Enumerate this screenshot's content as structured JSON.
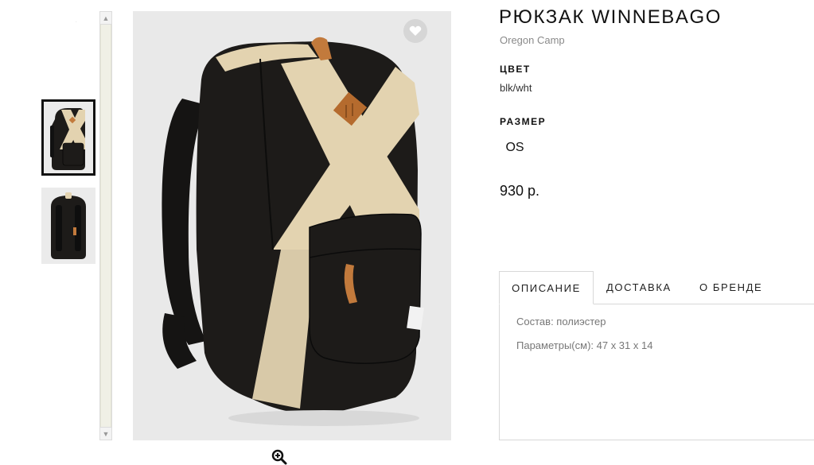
{
  "product": {
    "title": "РЮКЗАК WINNEBAGO",
    "brand": "Oregon Camp",
    "color_label": "ЦВЕТ",
    "color_value": "blk/wht",
    "size_label": "РАЗМЕР",
    "sizes": [
      "OS"
    ],
    "price": "930 р."
  },
  "tabs": [
    {
      "label": "ОПИСАНИЕ",
      "active": true
    },
    {
      "label": "ДОСТАВКА",
      "active": false
    },
    {
      "label": "О БРЕНДЕ",
      "active": false
    }
  ],
  "description": {
    "composition": "Состав: полиэстер",
    "params": "Параметры(см):  47 х 31 х 14"
  },
  "icons": {
    "favorite": "heart-icon",
    "zoom": "zoom-in-icon",
    "scroll_up": "scroll-up-arrow-icon",
    "scroll_down": "scroll-down-arrow-icon"
  },
  "colors": {
    "bag_body": "#1d1b19",
    "bag_panel": "#e3d3b0",
    "leather": "#c27a3c",
    "image_bg": "#e9e9e9",
    "selected_thumb_border": "#111111"
  }
}
